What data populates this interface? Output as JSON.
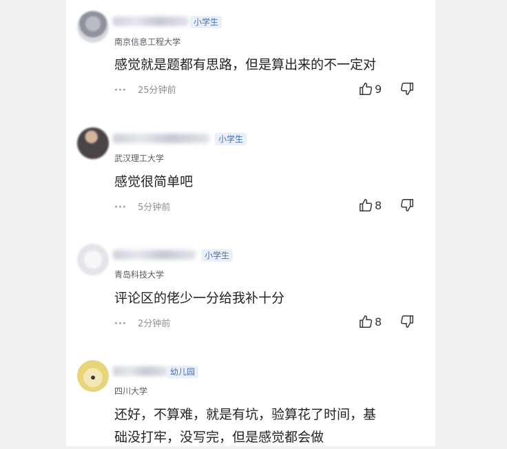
{
  "comments": [
    {
      "badge": "小学生",
      "school": "南京信息工程大学",
      "text": "感觉就是题都有思路，但是算出来的不一定对",
      "more": "···",
      "time": "25分钟前",
      "likes": "9",
      "avatar_color": "#d6d8dd"
    },
    {
      "badge": "小学生",
      "school": "武汉理工大学",
      "text": "感觉很简单吧",
      "more": "···",
      "time": "5分钟前",
      "likes": "8",
      "avatar_color": "#4a4446"
    },
    {
      "badge": "小学生",
      "school": "青岛科技大学",
      "text": "评论区的佬少一分给我补十分",
      "more": "···",
      "time": "2分钟前",
      "likes": "8",
      "avatar_color": "#eceef2"
    },
    {
      "badge": "幼儿园",
      "school": "四川大学",
      "text_line1": "还好，不算难，就是有坑，验算花了时间，基",
      "text_line2": "础没打牢，没写完，但是感觉都会做",
      "avatar_color": "#e8d57a"
    }
  ]
}
